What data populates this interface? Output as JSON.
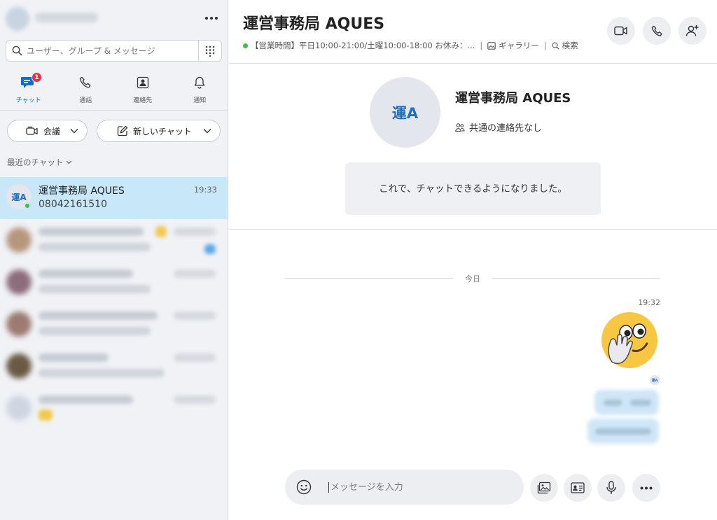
{
  "sidebar": {
    "search_placeholder": "ユーザー、グループ & メッセージ",
    "tabs": [
      {
        "label": "チャット",
        "badge": "1"
      },
      {
        "label": "通話"
      },
      {
        "label": "連絡先"
      },
      {
        "label": "通知"
      }
    ],
    "meeting_label": "会議",
    "new_chat_label": "新しいチャット",
    "recent_label": "最近のチャット",
    "chats": [
      {
        "avatar": "運A",
        "name": "運営事務局 AQUES",
        "last": "08042161510",
        "time": "19:33"
      }
    ]
  },
  "main": {
    "title": "運営事務局 AQUES",
    "status_text": "【営業時間】平日10:00-21:00/土曜10:00-18:00 お休み：...",
    "status_sep": "|",
    "gallery_label": "ギャラリー",
    "search_label": "検索",
    "profile": {
      "avatar": "運A",
      "name": "運営事務局 AQUES",
      "contacts": "共通の連絡先なし"
    },
    "notice": "これで、チャットできるようになりました。",
    "date_separator": "今日",
    "message_time": "19:32",
    "read_receipt_avatar": "運A",
    "composer_placeholder": "メッセージを入力"
  },
  "colors": {
    "accent": "#0b6fce",
    "online": "#3cc24a",
    "badge": "#e3304b",
    "selected_chat": "#c8e8f9"
  }
}
